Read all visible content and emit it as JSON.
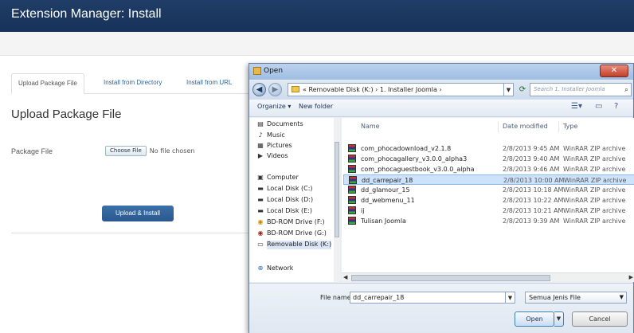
{
  "app": {
    "header_title": "Extension Manager: Install"
  },
  "tabs": [
    "Upload Package File",
    "Install from Directory",
    "Install from URL"
  ],
  "main": {
    "heading": "Upload Package File",
    "package_label": "Package File",
    "file_button": "Choose File",
    "file_status": "No file chosen",
    "upload_button": "Upload & Install"
  },
  "dialog": {
    "title": "Open",
    "close_glyph": "✕",
    "address": "« Removable Disk (K:) › 1. Installer Joomla ›",
    "search_placeholder": "Search 1. Installer Joomla",
    "toolbar": {
      "organize": "Organize ▾",
      "new_folder": "New folder"
    },
    "nav_items": [
      {
        "label": "Documents",
        "icon": "documents-icon"
      },
      {
        "label": "Music",
        "icon": "music-icon"
      },
      {
        "label": "Pictures",
        "icon": "pictures-icon"
      },
      {
        "label": "Videos",
        "icon": "videos-icon"
      },
      {
        "label": "Computer",
        "icon": "computer-icon"
      },
      {
        "label": "Local Disk (C:)",
        "icon": "disk-icon"
      },
      {
        "label": "Local Disk (D:)",
        "icon": "disk-icon"
      },
      {
        "label": "Local Disk (E:)",
        "icon": "disk-icon"
      },
      {
        "label": "BD-ROM Drive (F:)",
        "icon": "disc-drive-icon"
      },
      {
        "label": "BD-ROM Drive (G:)",
        "icon": "disc-drive-icon"
      },
      {
        "label": "Removable Disk (K:)",
        "icon": "usb-drive-icon"
      },
      {
        "label": "Network",
        "icon": "network-icon"
      }
    ],
    "columns": {
      "name": "Name",
      "date": "Date modified",
      "type": "Type"
    },
    "files": [
      {
        "name": "com_phocadownload_v2.1.8",
        "date": "2/8/2013 9:45 AM",
        "type": "WinRAR ZIP archive"
      },
      {
        "name": "com_phocagallery_v3.0.0_alpha3",
        "date": "2/8/2013 9:40 AM",
        "type": "WinRAR ZIP archive"
      },
      {
        "name": "com_phocaguestbook_v3.0.0_alpha",
        "date": "2/8/2013 9:46 AM",
        "type": "WinRAR ZIP archive"
      },
      {
        "name": "dd_carrepair_18",
        "date": "2/8/2013 10:00 AM",
        "type": "WinRAR ZIP archive",
        "selected": true
      },
      {
        "name": "dd_glamour_15",
        "date": "2/8/2013 10:18 AM",
        "type": "WinRAR ZIP archive"
      },
      {
        "name": "dd_webmenu_11",
        "date": "2/8/2013 10:22 AM",
        "type": "WinRAR ZIP archive"
      },
      {
        "name": "ij",
        "date": "2/8/2013 10:21 AM",
        "type": "WinRAR ZIP archive"
      },
      {
        "name": "Tulisan Joomla",
        "date": "2/8/2013 9:39 AM",
        "type": "WinRAR ZIP archive"
      }
    ],
    "file_name_label": "File name:",
    "file_name_value": "dd_carrepair_18",
    "filter": "Semua Jenis File",
    "open_button": "Open",
    "cancel_button": "Cancel"
  }
}
